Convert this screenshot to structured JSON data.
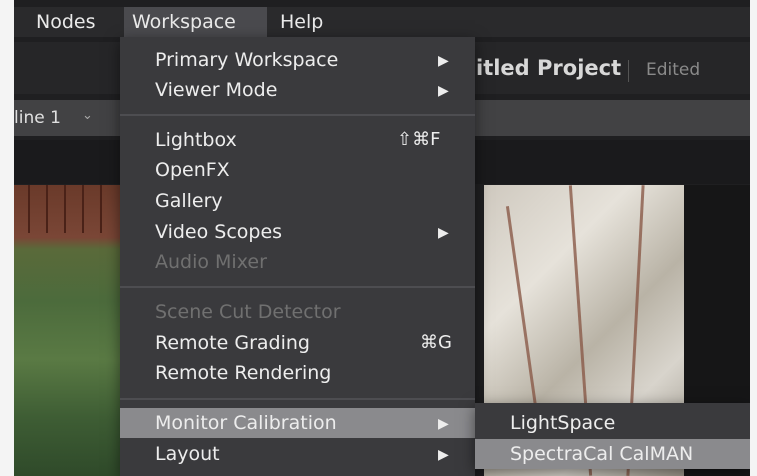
{
  "menubar": {
    "items": [
      "Nodes",
      "Workspace",
      "Help"
    ]
  },
  "project": {
    "title_fragment": "itled Project",
    "status": "Edited"
  },
  "timeline": {
    "selector_label": "line 1"
  },
  "workspace_menu": {
    "items": [
      {
        "label": "Primary Workspace",
        "submenu": true
      },
      {
        "label": "Viewer Mode",
        "submenu": true
      },
      {
        "label": "Lightbox",
        "shortcut": "⇧⌘F"
      },
      {
        "label": "OpenFX"
      },
      {
        "label": "Gallery"
      },
      {
        "label": "Video Scopes",
        "submenu": true
      },
      {
        "label": "Audio Mixer",
        "disabled": true
      },
      {
        "label": "Scene Cut Detector",
        "disabled": true
      },
      {
        "label": "Remote Grading",
        "shortcut": "⌘G"
      },
      {
        "label": "Remote Rendering"
      },
      {
        "label": "Monitor Calibration",
        "submenu": true,
        "highlighted": true
      },
      {
        "label": "Layout",
        "submenu": true
      }
    ]
  },
  "calibration_submenu": {
    "items": [
      {
        "label": "LightSpace"
      },
      {
        "label": "SpectraCal CalMAN",
        "highlighted": true
      }
    ]
  },
  "colors": {
    "menu_bg": "#3a3a3d",
    "highlight": "#8a8a8d",
    "disabled_text": "#707070"
  }
}
